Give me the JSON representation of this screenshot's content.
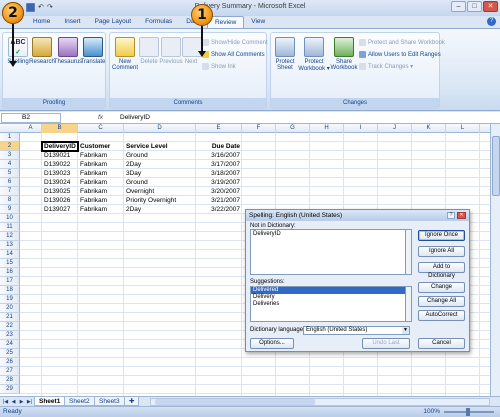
{
  "window": {
    "title": "Delivery Summary - Microsoft Excel",
    "controls": {
      "minimize": "–",
      "maximize": "□",
      "close": "✕"
    }
  },
  "ribbon": {
    "tabs": [
      "Home",
      "Insert",
      "Page Layout",
      "Formulas",
      "Data",
      "Review",
      "View"
    ],
    "active_tab": "Review",
    "groups": {
      "proofing": {
        "label": "Proofing",
        "buttons": [
          "Spelling",
          "Research",
          "Thesaurus",
          "Translate"
        ]
      },
      "comments": {
        "label": "Comments",
        "new_comment": "New Comment",
        "delete": "Delete",
        "previous": "Previous",
        "next": "Next",
        "show_hide": "Show/Hide Comment",
        "show_all": "Show All Comments",
        "show_ink": "Show Ink"
      },
      "changes": {
        "label": "Changes",
        "protect_sheet": "Protect Sheet",
        "protect_workbook": "Protect Workbook ▾",
        "share_workbook": "Share Workbook",
        "protect_share": "Protect and Share Workbook",
        "allow_users": "Allow Users to Edit Ranges",
        "track_changes": "Track Changes ▾"
      }
    }
  },
  "callouts": [
    "1",
    "2"
  ],
  "formula_bar": {
    "name_box": "B2",
    "fx": "fx",
    "content": "DeliveryID"
  },
  "columns": [
    "A",
    "B",
    "C",
    "D",
    "E",
    "F",
    "G",
    "H",
    "I",
    "J",
    "K",
    "L",
    "M"
  ],
  "rows": [
    "1",
    "2",
    "3",
    "4",
    "5",
    "6",
    "7",
    "8",
    "9",
    "10",
    "11",
    "12",
    "13",
    "14",
    "15",
    "16",
    "17",
    "18",
    "19",
    "20",
    "21",
    "22",
    "23",
    "24",
    "25",
    "26",
    "27",
    "28",
    "29"
  ],
  "table": {
    "headers": [
      "DeliveryID",
      "Customer",
      "Service Level",
      "Due Date"
    ],
    "rows": [
      [
        "D139021",
        "Fabrikam",
        "Ground",
        "3/16/2007"
      ],
      [
        "D139022",
        "Fabrikam",
        "2Day",
        "3/17/2007"
      ],
      [
        "D139023",
        "Fabrikam",
        "3Day",
        "3/18/2007"
      ],
      [
        "D139024",
        "Fabrikam",
        "Ground",
        "3/19/2007"
      ],
      [
        "D139025",
        "Fabrikam",
        "Overnight",
        "3/20/2007"
      ],
      [
        "D139026",
        "Fabrikam",
        "Priority Overnight",
        "3/21/2007"
      ],
      [
        "D139027",
        "Fabrikam",
        "2Day",
        "3/22/2007"
      ]
    ]
  },
  "sheets": [
    "Sheet1",
    "Sheet2",
    "Sheet3"
  ],
  "status": {
    "text": "Ready",
    "zoom": "100%"
  },
  "dialog": {
    "title": "Spelling: English (United States)",
    "not_in_dictionary_label": "Not in Dictionary:",
    "not_in_dictionary_value": "DeliveryID",
    "suggestions_label": "Suggestions:",
    "suggestions": [
      "Delivered",
      "Delivery",
      "Deliveries"
    ],
    "language_label": "Dictionary language:",
    "language_value": "English (United States)",
    "buttons": {
      "ignore_once": "Ignore Once",
      "ignore_all": "Ignore All",
      "add_to_dictionary": "Add to Dictionary",
      "change": "Change",
      "change_all": "Change All",
      "autocorrect": "AutoCorrect",
      "options": "Options...",
      "undo_last": "Undo Last",
      "cancel": "Cancel"
    }
  }
}
